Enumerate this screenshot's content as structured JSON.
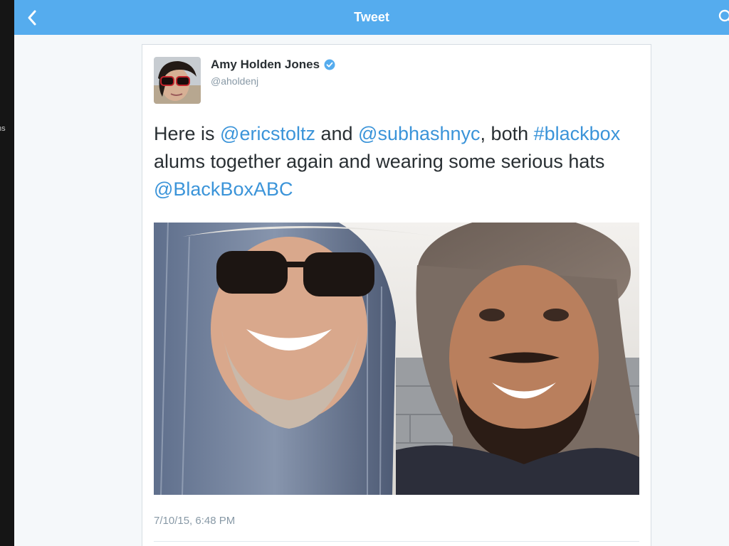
{
  "background_app": {
    "peek_text": "ns"
  },
  "navbar": {
    "title": "Tweet",
    "back_icon": "chevron-left-icon",
    "search_icon": "search-icon",
    "color": "#55acee"
  },
  "tweet": {
    "author": {
      "name": "Amy Holden Jones",
      "handle": "@aholdenj",
      "verified": true,
      "verified_icon": "verified-badge-icon"
    },
    "text_parts": [
      {
        "text": "Here is ",
        "type": "text"
      },
      {
        "text": "@ericstoltz",
        "type": "mention"
      },
      {
        "text": " and ",
        "type": "text"
      },
      {
        "text": "@subhashnyc",
        "type": "mention"
      },
      {
        "text": ", both ",
        "type": "text"
      },
      {
        "text": "#blackbox",
        "type": "hashtag"
      },
      {
        "text": " alums together again and wearing some serious hats ",
        "type": "text"
      },
      {
        "text": "@BlackBoxABC",
        "type": "mention"
      }
    ],
    "timestamp": "7/10/15, 6:48 PM",
    "link_color": "#3b94d9"
  }
}
